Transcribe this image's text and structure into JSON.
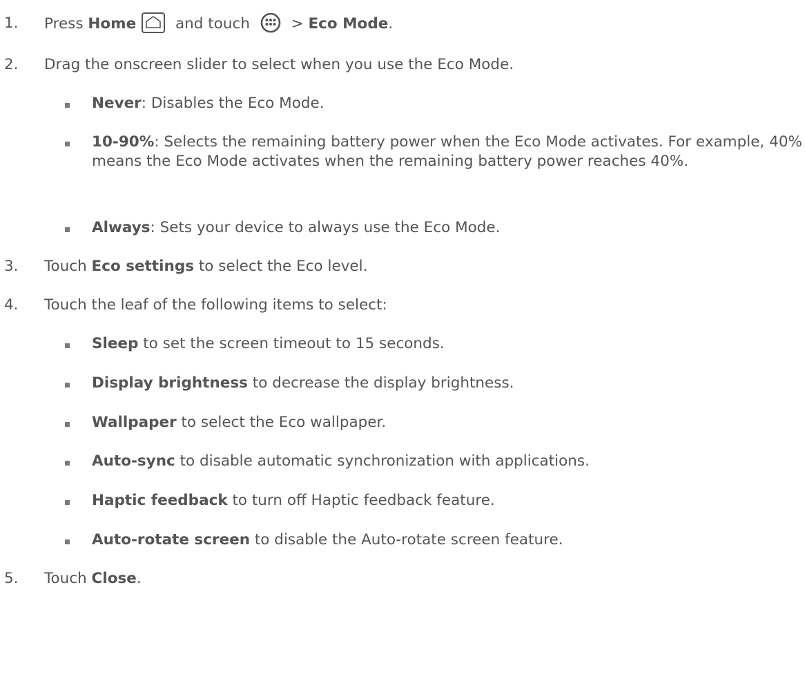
{
  "steps": [
    {
      "num": "1.",
      "parts": {
        "a": "Press ",
        "b": "Home",
        "c": " and touch ",
        "d": " > ",
        "e": "Eco Mode",
        "f": "."
      }
    },
    {
      "num": "2.",
      "text": "Drag the onscreen slider to select when you use the Eco Mode.",
      "bullets": [
        {
          "label": "Never",
          "text": ": Disables the Eco Mode."
        },
        {
          "label": "10-90%",
          "text": ": Selects the remaining battery power when the Eco Mode activates. For example, 40% means the Eco Mode activates when the remaining battery power reaches 40%."
        },
        {
          "label": "Always",
          "text": ": Sets your device to always use the Eco Mode."
        }
      ]
    },
    {
      "num": "3.",
      "parts": {
        "a": "Touch ",
        "b": "Eco settings",
        "c": " to select the Eco level."
      }
    },
    {
      "num": "4.",
      "text": "Touch the leaf of the following items to select:",
      "bullets": [
        {
          "label": "Sleep",
          "text": " to set the screen timeout to 15 seconds."
        },
        {
          "label": "Display brightness",
          "text": " to decrease the display brightness."
        },
        {
          "label": "Wallpaper",
          "text": " to select the Eco wallpaper."
        },
        {
          "label": "Auto-sync",
          "text": " to disable automatic synchronization with applications."
        },
        {
          "label": "Haptic feedback",
          "text": " to turn off Haptic feedback feature."
        },
        {
          "label": "Auto-rotate screen",
          "text": " to disable the Auto-rotate screen feature."
        }
      ]
    },
    {
      "num": "5.",
      "parts": {
        "a": "Touch ",
        "b": "Close",
        "c": "."
      }
    }
  ],
  "icons": {
    "home": "home-icon",
    "apps": "apps-icon"
  }
}
